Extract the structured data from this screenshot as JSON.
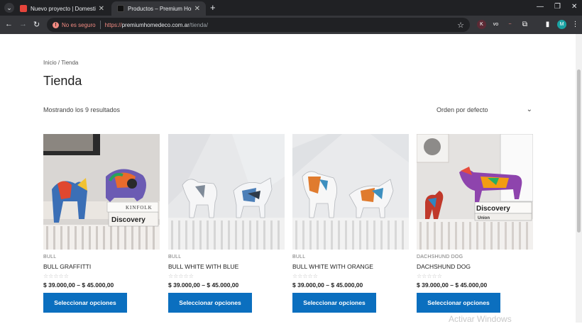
{
  "browser": {
    "tabs": [
      {
        "title": "Nuevo proyecto | Domestika",
        "active": false,
        "favicon_color": "#e5443b"
      },
      {
        "title": "Productos – Premium Home De",
        "active": true,
        "favicon_color": "#111111"
      }
    ],
    "security_label": "No es seguro",
    "url_scheme": "https://",
    "url_host": "premiumhomedeco.com.ar",
    "url_path": "/tienda/",
    "profile_initial": "M",
    "ext_badges": [
      "K",
      "vo",
      "~"
    ]
  },
  "page": {
    "breadcrumb": "Inicio / Tienda",
    "title": "Tienda",
    "result_count": "Mostrando los 9 resultados",
    "sort_label": "Orden por defecto"
  },
  "products": [
    {
      "category": "BULL",
      "name": "BULL GRAFFITTI",
      "price": "$ 39.000,00 – $ 45.000,00",
      "button": "Seleccionar opciones",
      "rating": "☆☆☆☆☆",
      "book_text_1": "KINFOLK",
      "book_text_2": "Discovery"
    },
    {
      "category": "BULL",
      "name": "BULL WHITE WITH BLUE",
      "price": "$ 39.000,00 – $ 45.000,00",
      "button": "Seleccionar opciones",
      "rating": "☆☆☆☆☆"
    },
    {
      "category": "BULL",
      "name": "BULL WHITE WITH ORANGE",
      "price": "$ 39.000,00 – $ 45.000,00",
      "button": "Seleccionar opciones",
      "rating": "☆☆☆☆☆"
    },
    {
      "category": "DACHSHUND DOG",
      "name": "DACHSHUND DOG",
      "price": "$ 39.000,00 – $ 45.000,00",
      "button": "Seleccionar opciones",
      "rating": "☆☆☆☆☆",
      "book_text_1": "Discovery",
      "book_text_2": "Union"
    }
  ],
  "watermark": "Activar Windows",
  "colors": {
    "accent": "#0b6fbf",
    "chrome_dark": "#202124",
    "chrome_mid": "#35363a",
    "warning": "#f28b82"
  }
}
